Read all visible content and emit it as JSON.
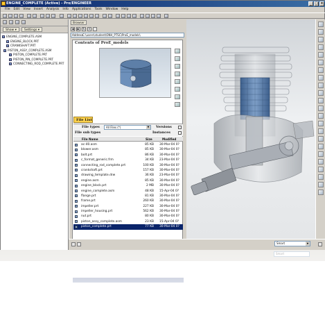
{
  "window": {
    "title": "ENGINE_COMPLETE (Active) - Pro/ENGINEER",
    "controls": [
      "_",
      "□",
      "×"
    ]
  },
  "menubar": [
    "File",
    "Edit",
    "View",
    "Insert",
    "Analysis",
    "Info",
    "Applications",
    "Tools",
    "Window",
    "Help"
  ],
  "left_panel": {
    "tabs": [
      "Show ▾",
      "Settings ▾"
    ],
    "tree": [
      "ENGINE_COMPLETE.ASM",
      "ENGINE_BLOCK.PRT",
      "CRANKSHAFT.PRT",
      "PISTON_ASSY_COMPLETE.ASM",
      "PISTON_COMPLETE.PRT",
      "PISTON_PIN_COMPLETE.PRT",
      "CONNECTING_ROD_COMPLETE.PRT"
    ]
  },
  "browser": {
    "tab": "Browser",
    "address_label": "Address",
    "address": "C:\\users\\student\\ONH_PTSC\\ProE_models\\",
    "contents_title": "Contents of ProE_models",
    "file_list_tab": "File List",
    "file_types_label": "File types",
    "file_types_value": "All Files (*)",
    "versions_label": "Versions",
    "file_sub_types_label": "File sub types",
    "instances_label": "Instances",
    "columns": {
      "name": "File Name",
      "size": "Size",
      "modified": "Modified"
    },
    "files": [
      {
        "name": "ac-40.asm",
        "size": "85 KB",
        "modified": "30-Mar-04 0?"
      },
      {
        "name": "blower.asm",
        "size": "85 KB",
        "modified": "30-Mar-04 0?"
      },
      {
        "name": "bolt.prt",
        "size": "86 KB",
        "modified": "30-Mar-04 0?"
      },
      {
        "name": "c_format_generic.frm",
        "size": "34 KB",
        "modified": "23-Mar-04 0?"
      },
      {
        "name": "connecting_rod_complete.prt",
        "size": "100 KB",
        "modified": "30-Mar-04 0?"
      },
      {
        "name": "crankshaft.prt",
        "size": "157 KB",
        "modified": "30-Mar-04 0?"
      },
      {
        "name": "drawing_template.drw",
        "size": "36 KB",
        "modified": "23-Mar-04 0?"
      },
      {
        "name": "engine.asm",
        "size": "85 KB",
        "modified": "30-Mar-04 0?"
      },
      {
        "name": "engine_block.prt",
        "size": "2 MB",
        "modified": "30-Mar-04 0?"
      },
      {
        "name": "engine_complete.asm",
        "size": "48 KB",
        "modified": "15-Apr-04 0?"
      },
      {
        "name": "flange.prt",
        "size": "81 KB",
        "modified": "30-Mar-04 0?"
      },
      {
        "name": "frame.prt",
        "size": "260 KB",
        "modified": "30-Mar-04 0?"
      },
      {
        "name": "impeller.prt",
        "size": "227 KB",
        "modified": "30-Mar-04 0?"
      },
      {
        "name": "impeller_housing.prt",
        "size": "562 KB",
        "modified": "30-Mar-04 0?"
      },
      {
        "name": "nut.prt",
        "size": "80 KB",
        "modified": "30-Mar-04 0?"
      },
      {
        "name": "piston_assy_complete.asm",
        "size": "23 KB",
        "modified": "15-Apr-04 0?"
      },
      {
        "name": "piston_complete.prt",
        "size": "77 KB",
        "modified": "30-Mar-04 0?",
        "selected": true
      }
    ]
  },
  "status": {
    "combo_1": "Smart",
    "combo_2": "Smart"
  },
  "colors": {
    "titlebar": "#0a246a",
    "selection": "#0a246a",
    "file_list_tab": "#ffd24d",
    "panel": "#d4d0c8"
  }
}
